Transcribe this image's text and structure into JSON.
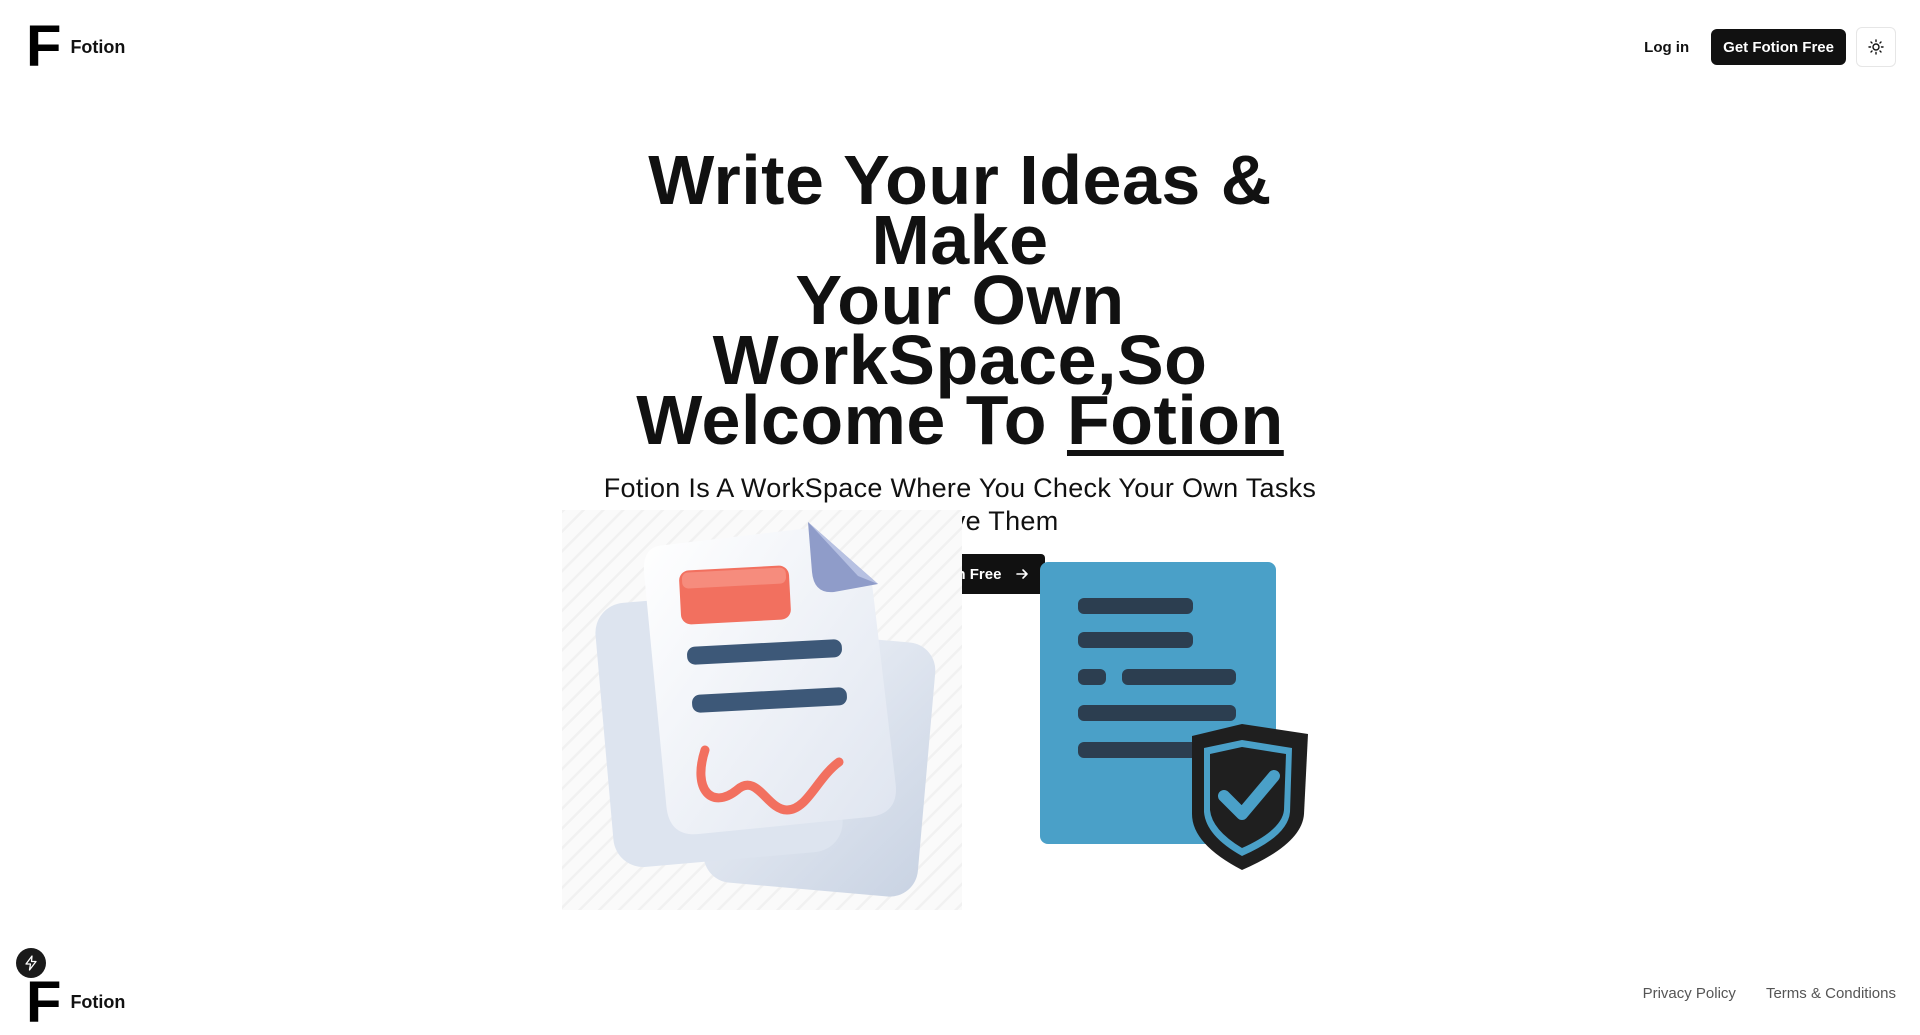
{
  "header": {
    "logo_letter": "F",
    "brand_name": "Fotion",
    "login_label": "Log in",
    "cta_label": "Get Fotion Free",
    "theme_toggle_icon": "sun-icon"
  },
  "hero": {
    "title_line1": "Write Your Ideas & Make",
    "title_line2": "Your Own WorkSpace,So",
    "title_line3_prefix": "Welcome To ",
    "title_accent": "Fotion",
    "subtitle": "Fotion Is A WorkSpace Where You Check Your Own Tasks And Save Them",
    "cta_label": "Get Fotion Free",
    "cta_icon": "arrow-right-icon"
  },
  "illustrations": {
    "left": "signed-document-illustration",
    "right": "secure-document-illustration"
  },
  "footer": {
    "logo_letter": "F",
    "brand_name": "Fotion",
    "links": [
      "Privacy Policy",
      "Terms & Conditions"
    ]
  },
  "floating_button_icon": "lightning-icon",
  "colors": {
    "primary": "#111111",
    "doc_blue": "#4aa0c8",
    "doc_bars": "#2c3e50",
    "accent_red": "#f2705f",
    "paper": "#e7ecf5"
  }
}
